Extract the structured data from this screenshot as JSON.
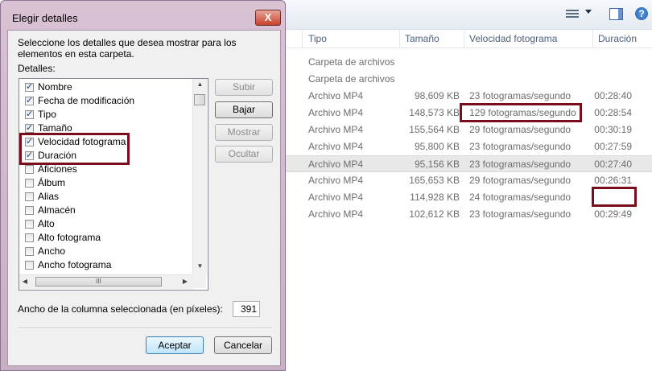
{
  "dialog": {
    "title": "Elegir detalles",
    "close_glyph": "X",
    "description": "Seleccione los detalles que desea mostrar para los elementos en esta carpeta.",
    "list_label": "Detalles:",
    "details": [
      {
        "label": "Nombre",
        "checked": true
      },
      {
        "label": "Fecha de modificación",
        "checked": true
      },
      {
        "label": "Tipo",
        "checked": true
      },
      {
        "label": "Tamaño",
        "checked": true
      },
      {
        "label": "Velocidad fotograma",
        "checked": true
      },
      {
        "label": "Duración",
        "checked": true
      },
      {
        "label": "Aficiones",
        "checked": false
      },
      {
        "label": "Álbum",
        "checked": false
      },
      {
        "label": "Alias",
        "checked": false
      },
      {
        "label": "Almacén",
        "checked": false
      },
      {
        "label": "Alto",
        "checked": false
      },
      {
        "label": "Alto fotograma",
        "checked": false
      },
      {
        "label": "Ancho",
        "checked": false
      },
      {
        "label": "Ancho fotograma",
        "checked": false
      }
    ],
    "buttons": {
      "subir": "Subir",
      "bajar": "Bajar",
      "mostrar": "Mostrar",
      "ocultar": "Ocultar",
      "aceptar": "Aceptar",
      "cancelar": "Cancelar"
    },
    "width_label": "Ancho de la columna seleccionada (en píxeles):",
    "width_value": "391",
    "scroll_glyphs": {
      "up": "▲",
      "down": "▼",
      "left": "◀",
      "right": "▶",
      "grip": "III"
    }
  },
  "explorer": {
    "toolbar": {
      "help_glyph": "?"
    },
    "columns": {
      "type": "Tipo",
      "size": "Tamaño",
      "framerate": "Velocidad fotograma",
      "duration": "Duración"
    },
    "rows": [
      {
        "type": "Carpeta de archivos",
        "size": "",
        "framerate": "",
        "duration": "",
        "selected": false
      },
      {
        "type": "Carpeta de archivos",
        "size": "",
        "framerate": "",
        "duration": "",
        "selected": false
      },
      {
        "type": "Archivo MP4",
        "size": "98,609 KB",
        "framerate": "23 fotogramas/segundo",
        "duration": "00:28:40",
        "selected": false
      },
      {
        "type": "Archivo MP4",
        "size": "148,573 KB",
        "framerate": "129 fotogramas/segundo",
        "duration": "00:28:54",
        "selected": false
      },
      {
        "type": "Archivo MP4",
        "size": "155,564 KB",
        "framerate": "29 fotogramas/segundo",
        "duration": "00:30:19",
        "selected": false
      },
      {
        "type": "Archivo MP4",
        "size": "95,800 KB",
        "framerate": "23 fotogramas/segundo",
        "duration": "00:27:59",
        "selected": false
      },
      {
        "type": "Archivo MP4",
        "size": "95,156 KB",
        "framerate": "23 fotogramas/segundo",
        "duration": "00:27:40",
        "selected": true
      },
      {
        "type": "Archivo MP4",
        "size": "165,653 KB",
        "framerate": "29 fotogramas/segundo",
        "duration": "00:26:31",
        "selected": false
      },
      {
        "type": "Archivo MP4",
        "size": "114,928 KB",
        "framerate": "24 fotogramas/segundo",
        "duration": "",
        "selected": false
      },
      {
        "type": "Archivo MP4",
        "size": "102,612 KB",
        "framerate": "23 fotogramas/segundo",
        "duration": "00:29:49",
        "selected": false
      }
    ]
  },
  "highlight_color": "#7a0c1c"
}
